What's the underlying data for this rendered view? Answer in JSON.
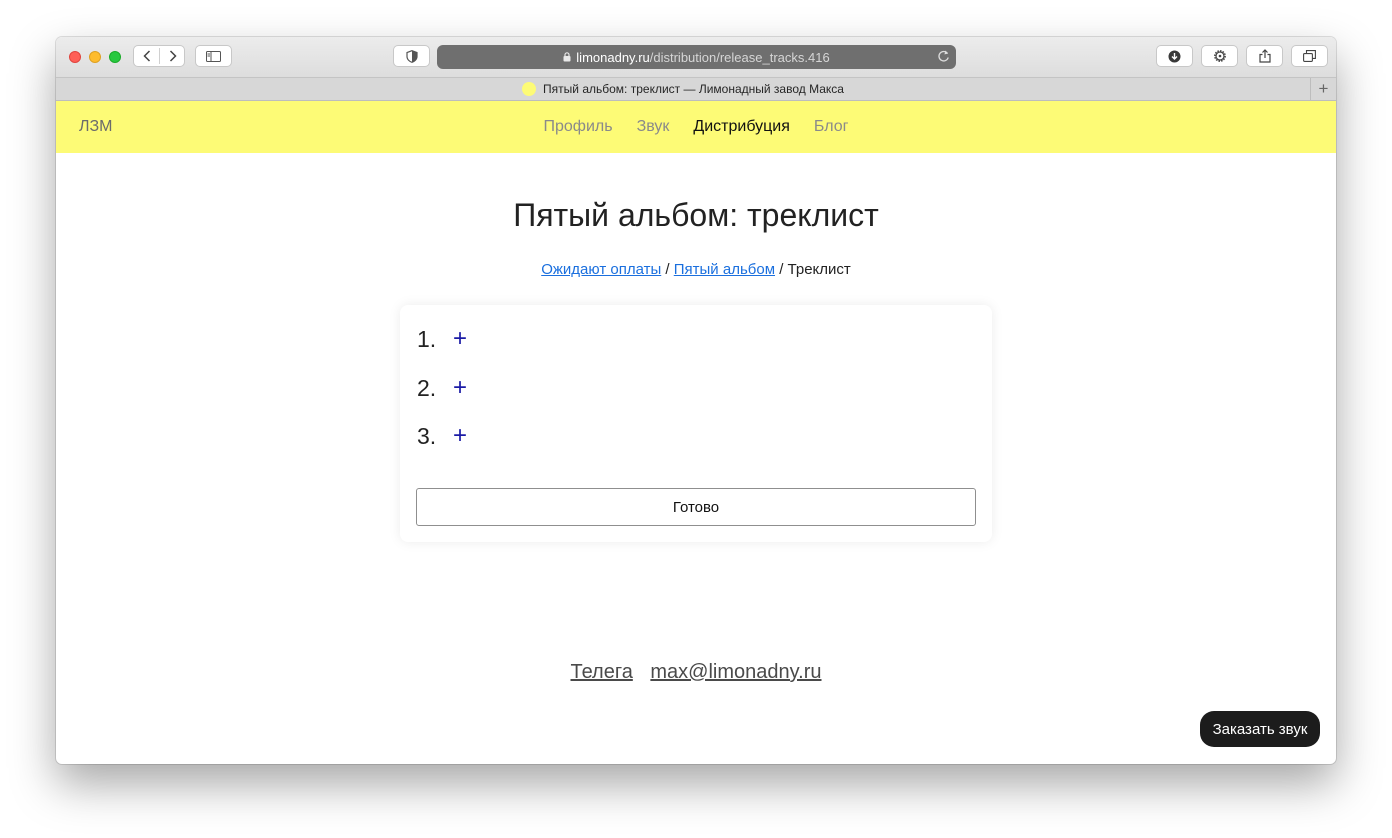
{
  "browser": {
    "url_domain": "limonadny.ru",
    "url_path": "/distribution/release_tracks.416",
    "tab_title": "Пятый альбом: треклист — Лимонадный завод Макса",
    "new_tab_label": "+"
  },
  "site": {
    "logo": "ЛЗМ",
    "nav": [
      {
        "label": "Профиль",
        "active": false
      },
      {
        "label": "Звук",
        "active": false
      },
      {
        "label": "Дистрибуция",
        "active": true
      },
      {
        "label": "Блог",
        "active": false
      }
    ],
    "accent_color": "#fdfb76"
  },
  "page": {
    "title": "Пятый альбом: треклист",
    "breadcrumb": {
      "link1": "Ожидают оплаты",
      "sep": "/",
      "link2": "Пятый альбом",
      "current": "Треклист"
    },
    "tracks": [
      {
        "number": "1.",
        "add": "+"
      },
      {
        "number": "2.",
        "add": "+"
      },
      {
        "number": "3.",
        "add": "+"
      }
    ],
    "done_button": "Готово"
  },
  "footer": {
    "telegram": "Телега",
    "email": "max@limonadny.ru"
  },
  "order_button": "Заказать звук"
}
